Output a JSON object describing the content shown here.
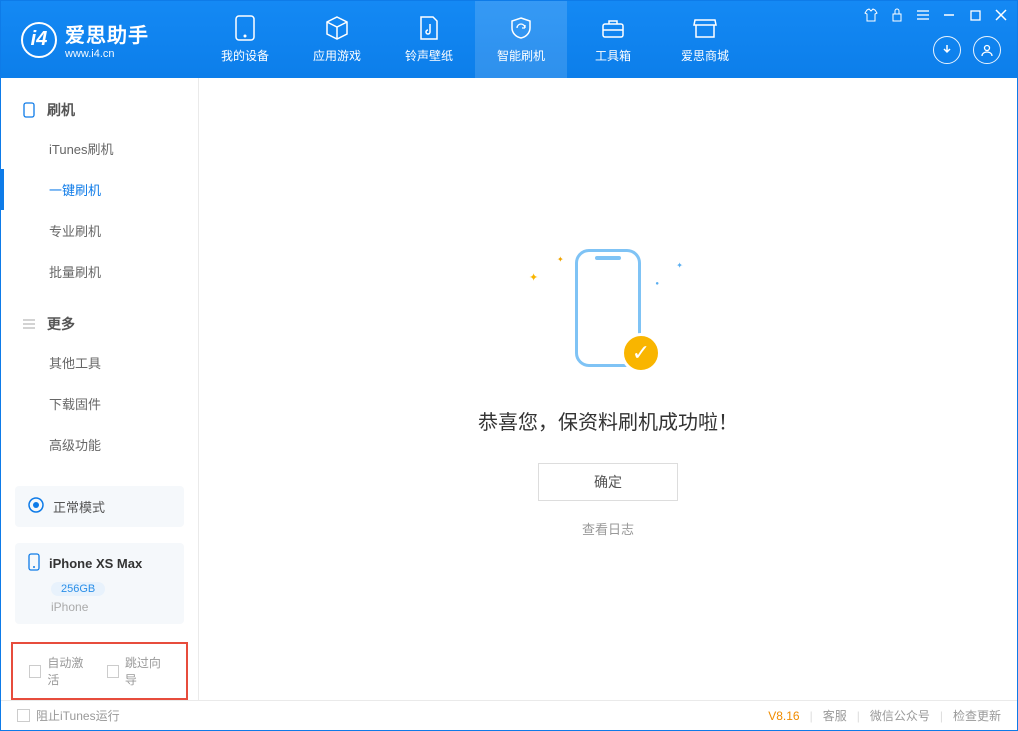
{
  "header": {
    "logo_title": "爱思助手",
    "logo_sub": "www.i4.cn",
    "tabs": [
      {
        "label": "我的设备"
      },
      {
        "label": "应用游戏"
      },
      {
        "label": "铃声壁纸"
      },
      {
        "label": "智能刷机"
      },
      {
        "label": "工具箱"
      },
      {
        "label": "爱思商城"
      }
    ]
  },
  "sidebar": {
    "group1_title": "刷机",
    "group1_items": [
      "iTunes刷机",
      "一键刷机",
      "专业刷机",
      "批量刷机"
    ],
    "group2_title": "更多",
    "group2_items": [
      "其他工具",
      "下载固件",
      "高级功能"
    ],
    "mode_label": "正常模式",
    "device_name": "iPhone XS Max",
    "device_capacity": "256GB",
    "device_type": "iPhone",
    "chk_auto_activate": "自动激活",
    "chk_skip_guide": "跳过向导"
  },
  "main": {
    "success_message": "恭喜您，保资料刷机成功啦！",
    "ok_button": "确定",
    "view_log": "查看日志"
  },
  "statusbar": {
    "block_itunes": "阻止iTunes运行",
    "version": "V8.16",
    "support": "客服",
    "wechat": "微信公众号",
    "update": "检查更新"
  }
}
